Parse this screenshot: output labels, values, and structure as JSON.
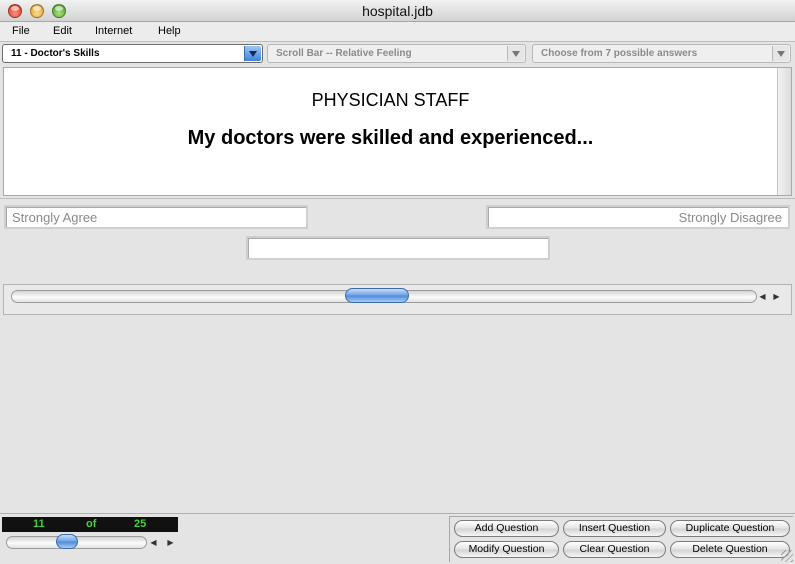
{
  "window": {
    "title": "hospital.jdb"
  },
  "menu": {
    "items": [
      "File",
      "Edit",
      "Internet",
      "Help"
    ]
  },
  "selectors": {
    "question": "11 - Doctor's Skills",
    "question_type": "Scroll Bar -- Relative Feeling",
    "answers": "Choose from 7 possible answers"
  },
  "question": {
    "heading": "PHYSICIAN STAFF",
    "text": "My doctors were skilled and experienced..."
  },
  "scale": {
    "left_label": "Strongly Agree",
    "right_label": "Strongly Disagree",
    "center_value": "",
    "slider_position": 0.49
  },
  "navigation": {
    "current": "11",
    "of_label": "of",
    "total": "25",
    "slider_position": 0.42
  },
  "actions": {
    "add": "Add Question",
    "insert": "Insert Question",
    "duplicate": "Duplicate Question",
    "modify": "Modify Question",
    "clear": "Clear Question",
    "delete": "Delete Question"
  },
  "icons": {
    "close": "close-button-icon",
    "minimize": "minimize-button-icon",
    "zoom": "zoom-button-icon",
    "step_left": "left-arrow-icon",
    "step_right": "right-arrow-icon",
    "dropdown": "chevron-down-icon"
  },
  "colors": {
    "counter_bg": "#111111",
    "counter_text": "#3fd13f",
    "slider_thumb": "#4d8ad8"
  }
}
